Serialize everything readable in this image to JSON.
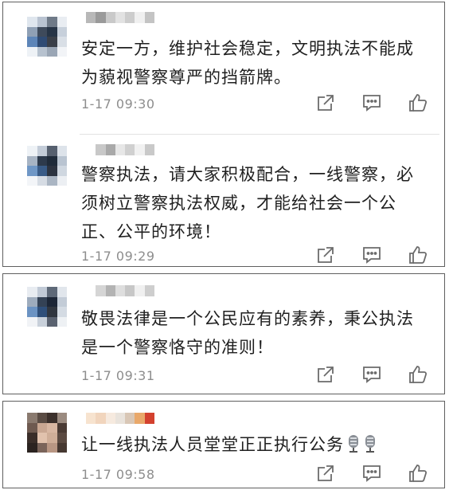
{
  "comments": [
    {
      "text": "安定一方，维护社会稳定，文明执法不能成为藐视警察尊严的挡箭牌。",
      "time": "1-17 09:30"
    },
    {
      "text": "警察执法，请大家积极配合，一线警察，必须树立警察执法权威，才能给社会一个公正、公平的环境！",
      "time": "1-17 09:29"
    },
    {
      "text": "敬畏法律是一个公民应有的素养，秉公执法是一个警察恪守的准则！",
      "time": "1-17 09:31"
    },
    {
      "text": "让一线执法人员堂堂正正执行公务",
      "time": "1-17 09:58",
      "emoji": [
        "microphone-emoji",
        "microphone-emoji"
      ]
    }
  ],
  "icons": {
    "share": "share-icon",
    "comment": "comment-icon",
    "like": "thumbs-up-icon"
  },
  "colors": {
    "text": "#1f1f1f",
    "time": "#8d8d8d",
    "icon": "#6b6b6b",
    "border": "#5f5f5f"
  }
}
